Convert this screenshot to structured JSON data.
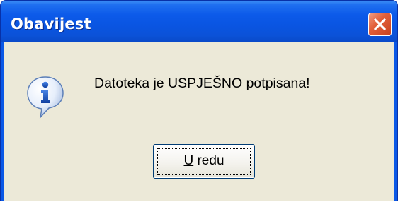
{
  "window": {
    "title": "Obavijest"
  },
  "titlebar": {
    "close_icon": "close-icon"
  },
  "dialog": {
    "icon": "information-icon",
    "message": "Datoteka je USPJEŠNO potpisana!",
    "ok_button": {
      "mnemonic": "U",
      "rest": " redu"
    }
  },
  "colors": {
    "titlebar": "#0a55e2",
    "client_background": "#ece9d8",
    "close_button": "#e2603b"
  }
}
